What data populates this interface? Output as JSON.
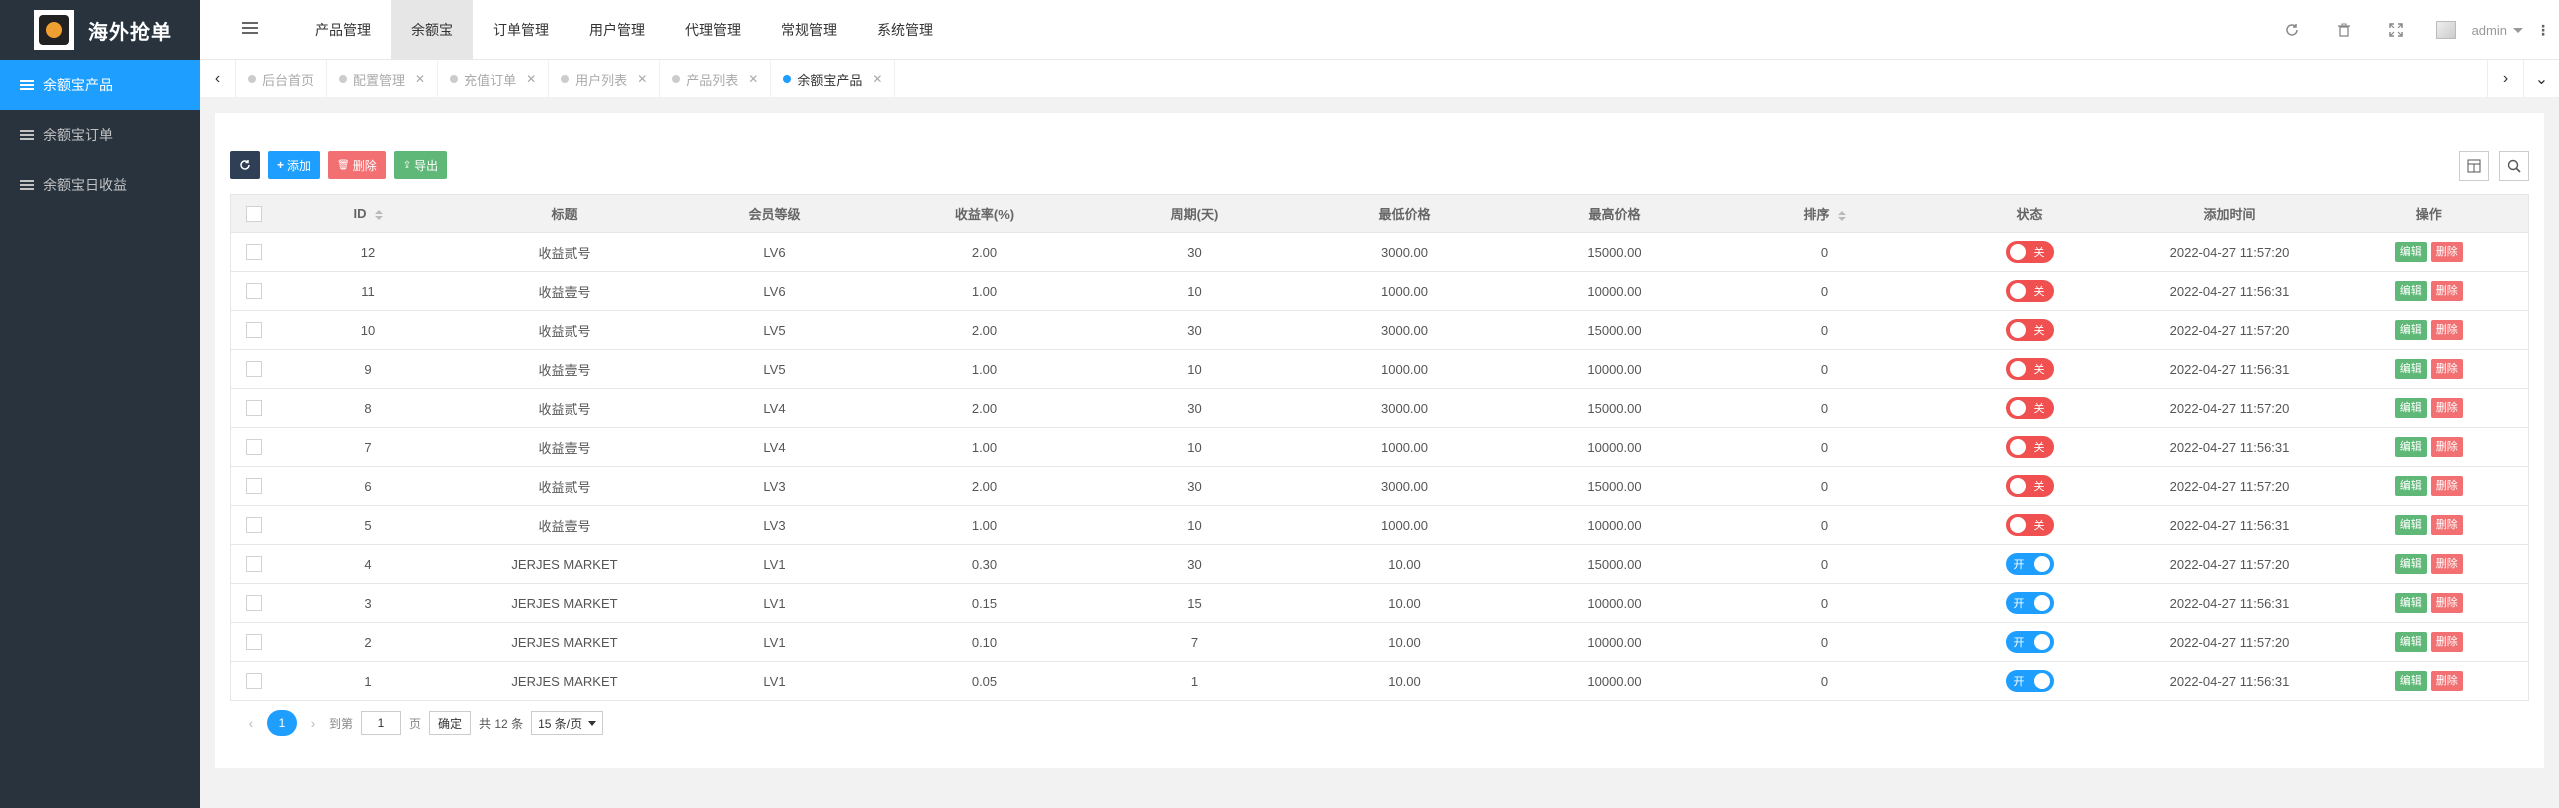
{
  "brand": {
    "title": "海外抢单"
  },
  "sidebar": {
    "items": [
      {
        "label": "余额宝产品",
        "active": true
      },
      {
        "label": "余额宝订单",
        "active": false
      },
      {
        "label": "余额宝日收益",
        "active": false
      }
    ]
  },
  "topnav": {
    "items": [
      {
        "label": "产品管理",
        "active": false
      },
      {
        "label": "余额宝",
        "active": true
      },
      {
        "label": "订单管理",
        "active": false
      },
      {
        "label": "用户管理",
        "active": false
      },
      {
        "label": "代理管理",
        "active": false
      },
      {
        "label": "常规管理",
        "active": false
      },
      {
        "label": "系统管理",
        "active": false
      }
    ]
  },
  "user": {
    "name": "admin"
  },
  "tabs": [
    {
      "label": "后台首页",
      "closable": false,
      "active": false
    },
    {
      "label": "配置管理",
      "closable": true,
      "active": false
    },
    {
      "label": "充值订单",
      "closable": true,
      "active": false
    },
    {
      "label": "用户列表",
      "closable": true,
      "active": false
    },
    {
      "label": "产品列表",
      "closable": true,
      "active": false
    },
    {
      "label": "余额宝产品",
      "closable": true,
      "active": true
    }
  ],
  "toolbar": {
    "add_label": "添加",
    "delete_label": "删除",
    "export_label": "导出"
  },
  "table": {
    "columns": [
      "ID",
      "标题",
      "会员等级",
      "收益率(%)",
      "周期(天)",
      "最低价格",
      "最高价格",
      "排序",
      "状态",
      "添加时间",
      "操作"
    ],
    "edit_label": "编辑",
    "delete_label": "删除",
    "switch_on_label": "开",
    "switch_off_label": "关",
    "rows": [
      {
        "id": "12",
        "title": "收益贰号",
        "level": "LV6",
        "rate": "2.00",
        "period": "30",
        "min": "3000.00",
        "max": "15000.00",
        "sort": "0",
        "status": false,
        "time": "2022-04-27 11:57:20"
      },
      {
        "id": "11",
        "title": "收益壹号",
        "level": "LV6",
        "rate": "1.00",
        "period": "10",
        "min": "1000.00",
        "max": "10000.00",
        "sort": "0",
        "status": false,
        "time": "2022-04-27 11:56:31"
      },
      {
        "id": "10",
        "title": "收益贰号",
        "level": "LV5",
        "rate": "2.00",
        "period": "30",
        "min": "3000.00",
        "max": "15000.00",
        "sort": "0",
        "status": false,
        "time": "2022-04-27 11:57:20"
      },
      {
        "id": "9",
        "title": "收益壹号",
        "level": "LV5",
        "rate": "1.00",
        "period": "10",
        "min": "1000.00",
        "max": "10000.00",
        "sort": "0",
        "status": false,
        "time": "2022-04-27 11:56:31"
      },
      {
        "id": "8",
        "title": "收益贰号",
        "level": "LV4",
        "rate": "2.00",
        "period": "30",
        "min": "3000.00",
        "max": "15000.00",
        "sort": "0",
        "status": false,
        "time": "2022-04-27 11:57:20"
      },
      {
        "id": "7",
        "title": "收益壹号",
        "level": "LV4",
        "rate": "1.00",
        "period": "10",
        "min": "1000.00",
        "max": "10000.00",
        "sort": "0",
        "status": false,
        "time": "2022-04-27 11:56:31"
      },
      {
        "id": "6",
        "title": "收益贰号",
        "level": "LV3",
        "rate": "2.00",
        "period": "30",
        "min": "3000.00",
        "max": "15000.00",
        "sort": "0",
        "status": false,
        "time": "2022-04-27 11:57:20"
      },
      {
        "id": "5",
        "title": "收益壹号",
        "level": "LV3",
        "rate": "1.00",
        "period": "10",
        "min": "1000.00",
        "max": "10000.00",
        "sort": "0",
        "status": false,
        "time": "2022-04-27 11:56:31"
      },
      {
        "id": "4",
        "title": "JERJES MARKET",
        "level": "LV1",
        "rate": "0.30",
        "period": "30",
        "min": "10.00",
        "max": "15000.00",
        "sort": "0",
        "status": true,
        "time": "2022-04-27 11:57:20"
      },
      {
        "id": "3",
        "title": "JERJES MARKET",
        "level": "LV1",
        "rate": "0.15",
        "period": "15",
        "min": "10.00",
        "max": "10000.00",
        "sort": "0",
        "status": true,
        "time": "2022-04-27 11:56:31"
      },
      {
        "id": "2",
        "title": "JERJES MARKET",
        "level": "LV1",
        "rate": "0.10",
        "period": "7",
        "min": "10.00",
        "max": "10000.00",
        "sort": "0",
        "status": true,
        "time": "2022-04-27 11:57:20"
      },
      {
        "id": "1",
        "title": "JERJES MARKET",
        "level": "LV1",
        "rate": "0.05",
        "period": "1",
        "min": "10.00",
        "max": "10000.00",
        "sort": "0",
        "status": true,
        "time": "2022-04-27 11:56:31"
      }
    ]
  },
  "pager": {
    "current": "1",
    "goto_label": "到第",
    "page_value": "1",
    "page_unit": "页",
    "confirm_label": "确定",
    "total_label": "共 12 条",
    "page_size_label": "15 条/页"
  },
  "colors": {
    "sidebar_bg": "#28333e",
    "accent": "#1e9fff",
    "danger": "#f05050",
    "success": "#5fb878"
  }
}
